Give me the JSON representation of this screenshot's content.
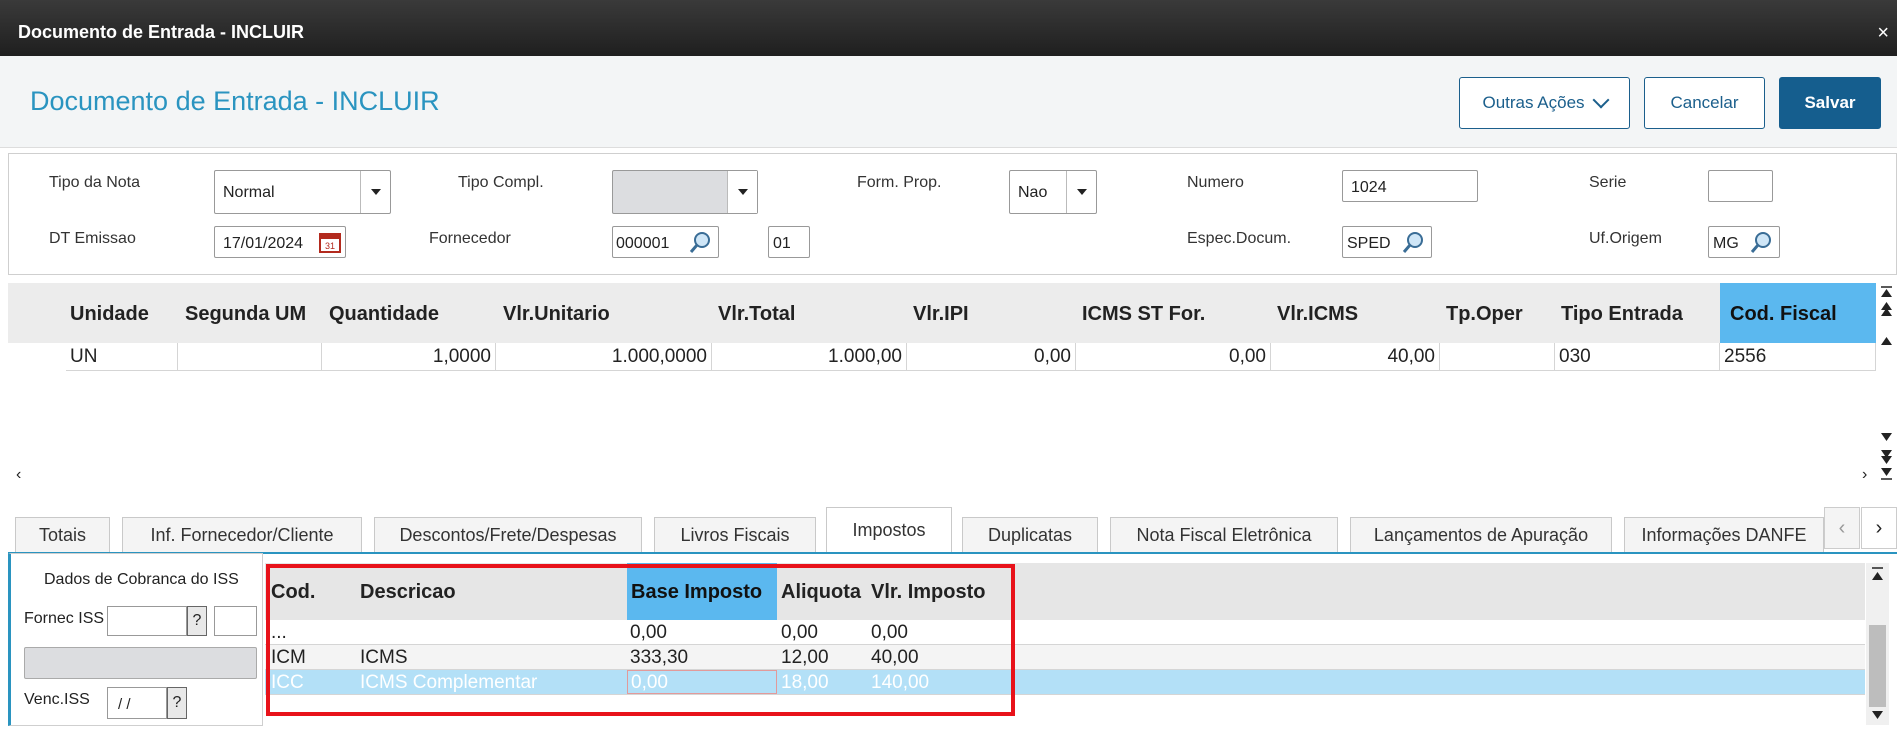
{
  "window": {
    "title": "Documento de Entrada - INCLUIR",
    "close": "×"
  },
  "header": {
    "title": "Documento de Entrada - INCLUIR",
    "outras_acoes": "Outras Ações",
    "cancelar": "Cancelar",
    "salvar": "Salvar"
  },
  "form": {
    "tipo_nota_label": "Tipo da Nota",
    "tipo_nota_value": "Normal",
    "tipo_compl_label": "Tipo Compl.",
    "tipo_compl_value": "",
    "form_prop_label": "Form. Prop.",
    "form_prop_value": "Nao",
    "numero_label": "Numero",
    "numero_value": "1024",
    "serie_label": "Serie",
    "serie_value": "",
    "dt_emissao_label": "DT Emissao",
    "dt_emissao_value": "17/01/2024",
    "fornecedor_label": "Fornecedor",
    "fornecedor_value": "000001",
    "loja_value": "01",
    "espec_label": "Espec.Docum.",
    "espec_value": "SPED",
    "uf_label": "Uf.Origem",
    "uf_value": "MG"
  },
  "items_grid": {
    "headers": [
      "Unidade",
      "Segunda UM",
      "Quantidade",
      "Vlr.Unitario",
      "Vlr.Total",
      "Vlr.IPI",
      "ICMS ST For.",
      "Vlr.ICMS",
      "Tp.Oper",
      "Tipo Entrada",
      "Cod. Fiscal"
    ],
    "row": [
      "UN",
      "",
      "1,0000",
      "1.000,0000",
      "1.000,00",
      "0,00",
      "0,00",
      "40,00",
      "",
      "030",
      "2556"
    ],
    "scroll_left": "‹",
    "scroll_right": "›"
  },
  "tabs": [
    "Totais",
    "Inf. Fornecedor/Cliente",
    "Descontos/Frete/Despesas",
    "Livros Fiscais",
    "Impostos",
    "Duplicatas",
    "Nota Fiscal Eletrônica",
    "Lançamentos de Apuração",
    "Informações DANFE"
  ],
  "tab_nav": {
    "prev": "‹",
    "next": "›"
  },
  "iss": {
    "title": "Dados de Cobranca do ISS",
    "fornec_label": "Fornec ISS",
    "help": "?",
    "venc_label": "Venc.ISS",
    "venc_value": " / /"
  },
  "tax_grid": {
    "headers": [
      "Cod.",
      "Descricao",
      "Base Imposto",
      "Aliquota",
      "Vlr. Imposto"
    ],
    "rows": [
      [
        "...",
        "",
        "0,00",
        "0,00",
        "0,00"
      ],
      [
        "ICM",
        "ICMS",
        "333,30",
        "12,00",
        "40,00"
      ],
      [
        "ICC",
        "ICMS Complementar",
        "0,00",
        "18,00",
        "140,00"
      ]
    ]
  },
  "colors": {
    "accent": "#2a94c0",
    "primary_button": "#155e8e",
    "highlight_column": "#5bb8ef",
    "selected_row": "#b3e0f7",
    "red_annotation": "#e8121a"
  }
}
